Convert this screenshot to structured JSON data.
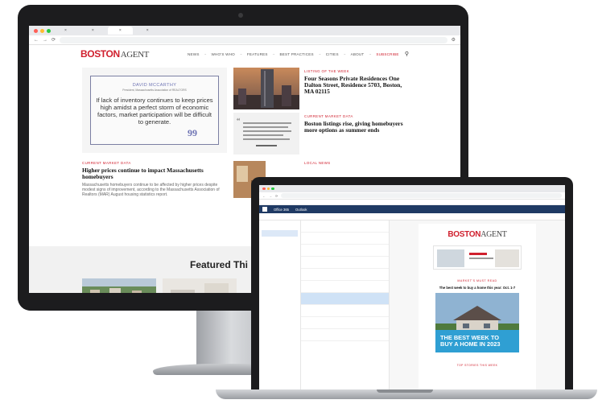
{
  "colors": {
    "brand_red": "#d0202e",
    "quote_accent": "#6e74b4",
    "outlook_blue": "#1f3a64",
    "hero_blue": "#2f9fd3"
  },
  "desktop": {
    "site": {
      "logo_main": "BOSTON",
      "logo_agent": "AGENT",
      "nav": [
        "NEWS",
        "WHO'S WHO",
        "FEATURES",
        "BEST PRACTICES",
        "CITIES",
        "ABOUT",
        "SUBSCRIBE"
      ],
      "quote": {
        "name": "DAVID MCCARTHY",
        "role": "President, Massachusetts Association of REALTORS",
        "text": "If lack of inventory continues to keep prices high amidst a perfect storm of economic factors, market participation will be difficult to generate.",
        "mark": "99"
      },
      "listing": {
        "kicker": "LISTING OF THE WEEK",
        "headline": "Four Seasons Private Residences One Dalton Street, Residence 5703, Boston, MA 02115"
      },
      "market": {
        "kicker": "CURRENT MARKET DATA",
        "headline": "Boston listings rise, giving homebuyers more options as summer ends"
      },
      "higher": {
        "kicker": "CURRENT MARKET DATA",
        "headline": "Higher prices continue to impact Massachusetts homebuyers",
        "dek": "Massachusetts homebuyers continue to be affected by higher prices despite modest signs of improvement, according to the Massachusetts Association of Realtors (MAR) August housing statistics report."
      },
      "local": {
        "kicker": "LOCAL NEWS"
      },
      "featured_title": "Featured Thi"
    }
  },
  "laptop": {
    "outlook": {
      "app_name": "Office 365",
      "app_section": "Outlook",
      "email": {
        "logo_main": "BOSTON",
        "logo_agent": "AGENT",
        "section_label": "MARKET'S MUST READ",
        "headline": "The best week to buy a home this year: Oct. 1-7",
        "hero_text_1": "THE BEST WEEK TO",
        "hero_text_2": "BUY A HOME IN 2023",
        "footer_label": "TOP STORIES THIS WEEK"
      }
    }
  }
}
